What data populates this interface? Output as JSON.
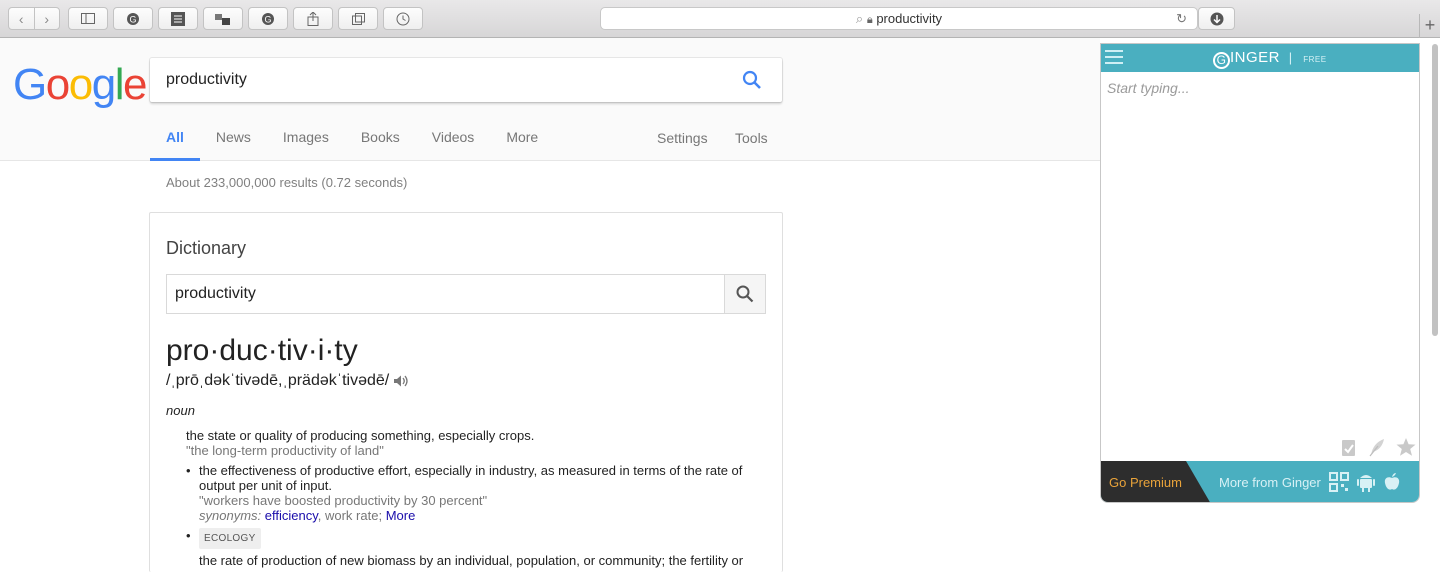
{
  "browser": {
    "url": "productivity",
    "new_tab_label": "+"
  },
  "google": {
    "logo_letters": [
      "G",
      "o",
      "o",
      "g",
      "l",
      "e"
    ],
    "query": "productivity",
    "tabs": [
      "All",
      "News",
      "Images",
      "Books",
      "Videos",
      "More"
    ],
    "right_tabs": [
      "Settings",
      "Tools"
    ],
    "stats": "About 233,000,000 results (0.72 seconds)"
  },
  "dictionary": {
    "title": "Dictionary",
    "query": "productivity",
    "headword": "pro·duc·tiv·i·ty",
    "phonetic": "/ˌprōˌdəkˈtivədē,ˌprädəkˈtivədē/",
    "part_of_speech": "noun",
    "def1": "the state or quality of producing something, especially crops.",
    "ex1": "\"the long-term productivity of land\"",
    "def2": "the effectiveness of productive effort, especially in industry, as measured in terms of the rate of output per unit of input.",
    "ex2": "\"workers have boosted productivity by 30 percent\"",
    "synonyms_label": "synonyms:",
    "synonym_link": "efficiency",
    "synonym_rest": ", work rate;",
    "more_link": "More",
    "ecology_badge": "ECOLOGY",
    "def3": "the rate of production of new biomass by an individual, population, or community; the fertility or"
  },
  "ginger": {
    "brand": "INGER",
    "brand_initial": "G",
    "plan": "FREE",
    "placeholder": "Start typing...",
    "premium": "Go Premium",
    "more": "More from Ginger"
  },
  "colors": {
    "google_blue": "#4285f4",
    "ginger_teal": "#4aafc0",
    "premium_orange": "#e9a33a"
  }
}
